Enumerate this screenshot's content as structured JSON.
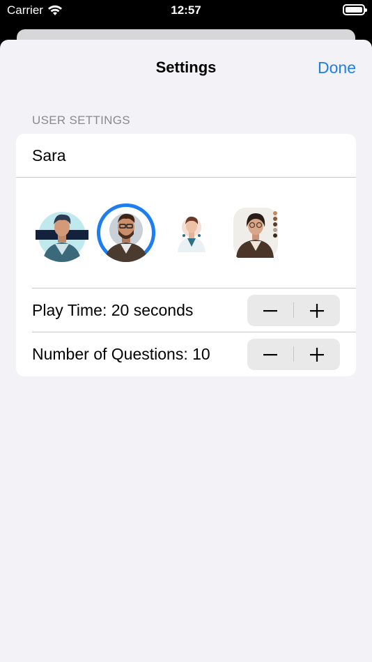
{
  "status_bar": {
    "carrier": "Carrier",
    "time": "12:57"
  },
  "navigation": {
    "title": "Settings",
    "done_label": "Done"
  },
  "section": {
    "header": "USER SETTINGS"
  },
  "user": {
    "name": "Sara"
  },
  "avatars": [
    {
      "id": "avatar-1",
      "selected": false
    },
    {
      "id": "avatar-2",
      "selected": true
    },
    {
      "id": "avatar-3",
      "selected": false
    },
    {
      "id": "avatar-4",
      "selected": false
    }
  ],
  "play_time": {
    "label": "Play Time: 20 seconds",
    "value": 20
  },
  "questions": {
    "label": "Number of Questions: 10",
    "value": 10
  },
  "colors": {
    "accent": "#1e7ef0",
    "background": "#f2f2f7",
    "card": "#ffffff"
  }
}
